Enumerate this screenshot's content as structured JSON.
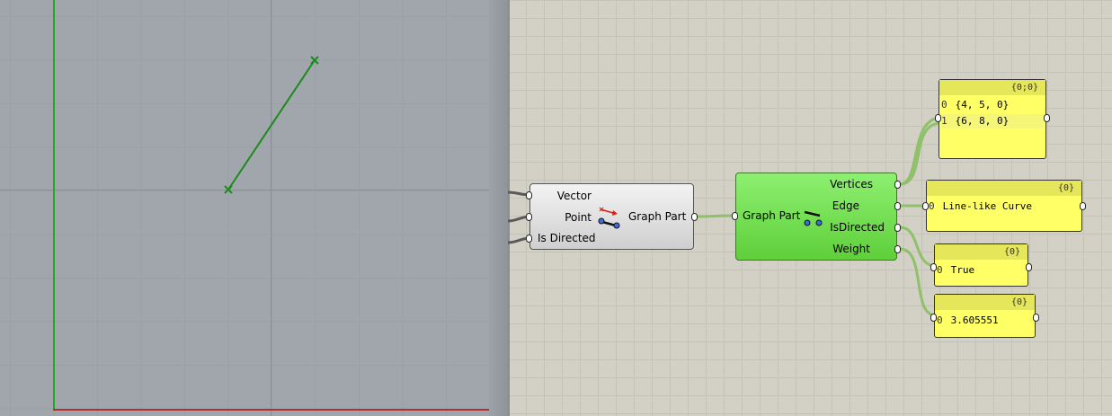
{
  "viewport": {
    "axis_colors": {
      "y": "#2aa52a",
      "x": "#b03030"
    },
    "line_color": "#1a8c1a",
    "point_marker": "cross"
  },
  "components": {
    "construct": {
      "inputs": [
        "Vector",
        "Point",
        "Is Directed"
      ],
      "output": "Graph Part",
      "icon": "graph-part-icon"
    },
    "deconstruct": {
      "input": "Graph Part",
      "outputs": [
        "Vertices",
        "Edge",
        "IsDirected",
        "Weight"
      ],
      "icon": "deconstruct-graph-part-icon",
      "color": "#6ee04a"
    }
  },
  "panels": {
    "vertices": {
      "header": "{0;0}",
      "rows": [
        {
          "index": "0",
          "value": "{4, 5, 0}"
        },
        {
          "index": "1",
          "value": "{6, 8, 0}"
        }
      ]
    },
    "edge": {
      "header": "{0}",
      "rows": [
        {
          "index": "0",
          "value": "Line-like Curve"
        }
      ]
    },
    "isdirected": {
      "header": "{0}",
      "rows": [
        {
          "index": "0",
          "value": "True"
        }
      ]
    },
    "weight": {
      "header": "{0}",
      "rows": [
        {
          "index": "0",
          "value": "3.605551"
        }
      ]
    }
  }
}
